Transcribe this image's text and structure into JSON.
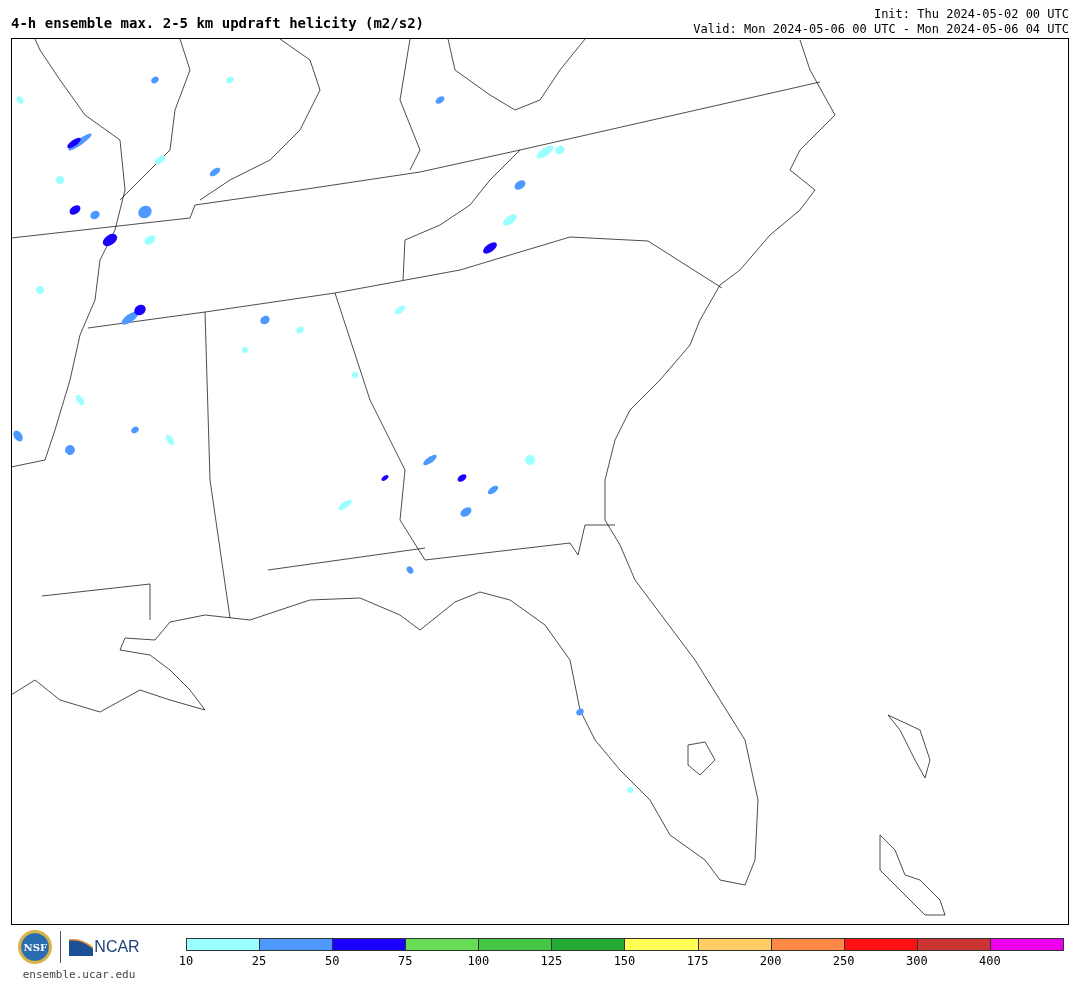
{
  "title": "4-h ensemble max. 2-5 km updraft helicity (m2/s2)",
  "init": "Init: Thu 2024-05-02 00 UTC",
  "valid": "Valid: Mon 2024-05-06 00 UTC - Mon 2024-05-06 04 UTC",
  "logos": {
    "nsf": "NSF",
    "ncar": "NCAR"
  },
  "site": "ensemble.ucar.edu",
  "colorbar": [
    {
      "color": "#99ffff",
      "label": "10"
    },
    {
      "color": "#4d99ff",
      "label": "25"
    },
    {
      "color": "#1a00ff",
      "label": "50"
    },
    {
      "color": "#66dd55",
      "label": "75"
    },
    {
      "color": "#44c744",
      "label": "100"
    },
    {
      "color": "#22aa33",
      "label": "125"
    },
    {
      "color": "#ffff55",
      "label": "150"
    },
    {
      "color": "#ffcc66",
      "label": "175"
    },
    {
      "color": "#ff8844",
      "label": "200"
    },
    {
      "color": "#ff1111",
      "label": "250"
    },
    {
      "color": "#cc3333",
      "label": "300"
    },
    {
      "color": "#ee00ee",
      "label": "400"
    }
  ]
}
